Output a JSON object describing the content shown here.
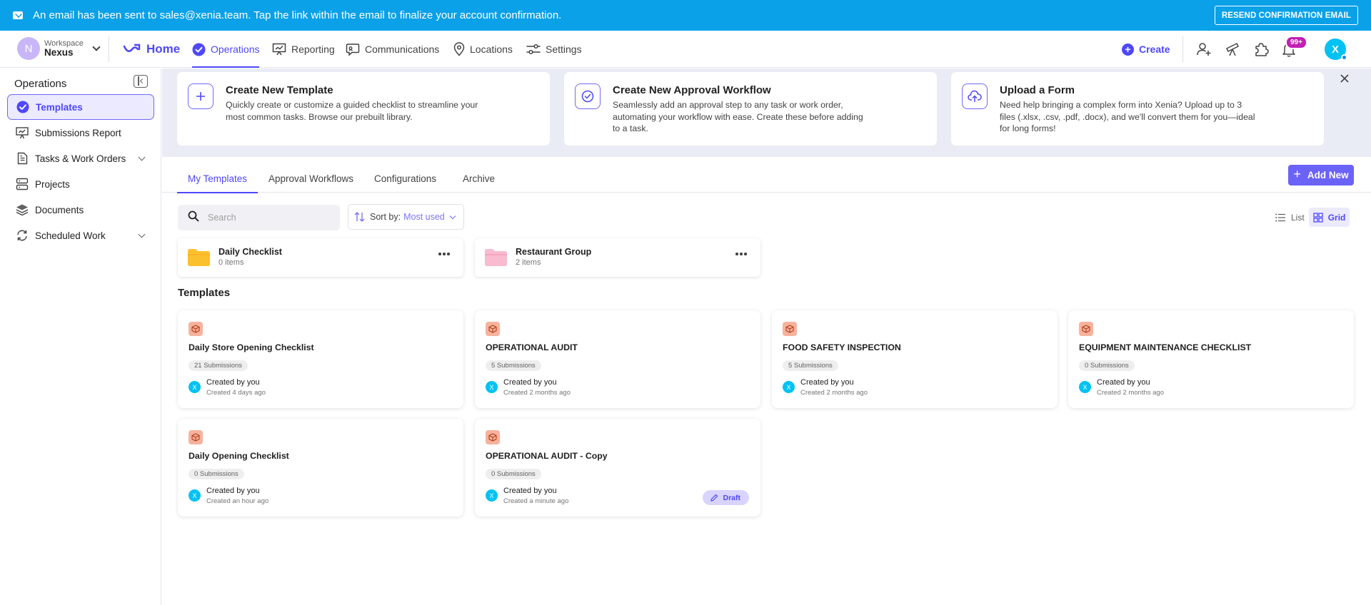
{
  "banner": {
    "message": "An email has been sent to sales@xenia.team. Tap the link within the email to finalize your account confirmation.",
    "resend_label": "RESEND CONFIRMATION EMAIL"
  },
  "workspace": {
    "avatar_letter": "N",
    "label": "Workspace",
    "name": "Nexus"
  },
  "nav": {
    "home": "Home",
    "items": [
      "Operations",
      "Reporting",
      "Communications",
      "Locations",
      "Settings"
    ],
    "create": "Create",
    "notifications_badge": "99+",
    "user_avatar": "X"
  },
  "sidebar": {
    "heading": "Operations",
    "items": [
      {
        "label": "Templates",
        "icon": "check-circle-icon"
      },
      {
        "label": "Submissions Report",
        "icon": "presentation-chart-icon"
      },
      {
        "label": "Tasks & Work Orders",
        "icon": "document-icon"
      },
      {
        "label": "Projects",
        "icon": "server-stack-icon"
      },
      {
        "label": "Documents",
        "icon": "layers-icon"
      },
      {
        "label": "Scheduled Work",
        "icon": "recurring-icon"
      }
    ]
  },
  "promos": [
    {
      "title": "Create New Template",
      "desc": "Quickly create or customize a guided checklist to streamline your most common tasks. Browse our prebuilt library."
    },
    {
      "title": "Create New Approval Workflow",
      "desc": "Seamlessly add an approval step to any task or work order, automating your workflow with ease. Create these before adding to a task."
    },
    {
      "title": "Upload a Form",
      "desc": "Need help bringing a complex form into Xenia? Upload up to 3 files (.xlsx, .csv, .pdf, .docx), and we'll convert them for you—ideal for long forms!"
    }
  ],
  "tabs": [
    "My Templates",
    "Approval Workflows",
    "Configurations",
    "Archive"
  ],
  "add_new": "Add New",
  "search": {
    "placeholder": "Search",
    "value": ""
  },
  "sort": {
    "label": "Sort by:",
    "value": "Most used"
  },
  "view": {
    "list": "List",
    "grid": "Grid",
    "selected": "Grid"
  },
  "folders": [
    {
      "name": "Daily Checklist",
      "count": "0 items",
      "color": "#fbc02d"
    },
    {
      "name": "Restaurant Group",
      "count": "2 items",
      "color": "#f8bbd0"
    }
  ],
  "section_title": "Templates",
  "templates": [
    {
      "name": "Daily Store Opening Checklist",
      "submissions": "21 Submissions",
      "created_by": "Created by you",
      "created_at": "Created 4 days ago"
    },
    {
      "name": "OPERATIONAL AUDIT",
      "submissions": "5 Submissions",
      "created_by": "Created by you",
      "created_at": "Created 2 months ago"
    },
    {
      "name": "FOOD SAFETY INSPECTION",
      "submissions": "5 Submissions",
      "created_by": "Created by you",
      "created_at": "Created 2 months ago"
    },
    {
      "name": "EQUIPMENT MAINTENANCE CHECKLIST",
      "submissions": "0 Submissions",
      "created_by": "Created by you",
      "created_at": "Created 2 months ago"
    },
    {
      "name": "Daily Opening Checklist",
      "submissions": "0 Submissions",
      "created_by": "Created by you",
      "created_at": "Created an hour ago"
    },
    {
      "name": "OPERATIONAL AUDIT - Copy",
      "submissions": "0 Submissions",
      "created_by": "Created by you",
      "created_at": "Created a minute ago",
      "status": "Draft"
    }
  ],
  "colors": {
    "accent": "#4e48fa",
    "banner": "#0aa1e8",
    "template_icon": "#f7b29d",
    "avatar": "#00c2f3"
  }
}
